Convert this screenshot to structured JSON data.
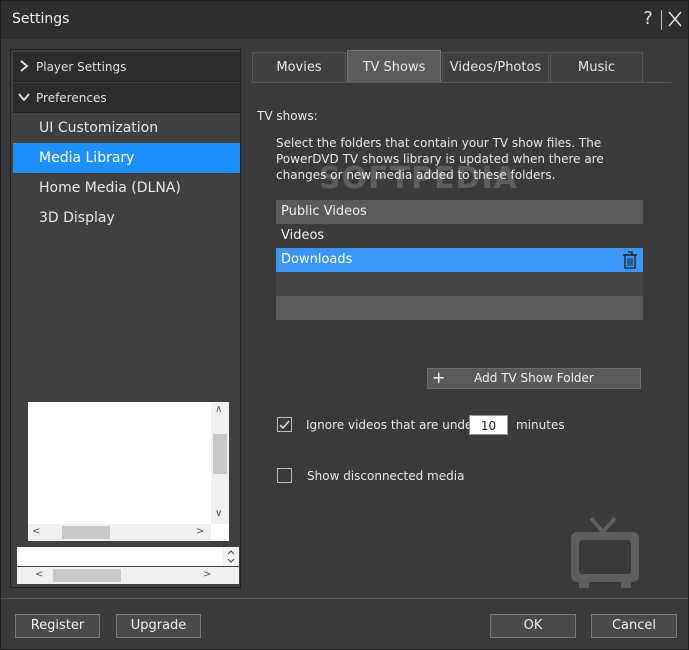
{
  "window": {
    "title": "Settings",
    "help_label": "?"
  },
  "sidebar": {
    "sections": [
      {
        "label": "Player Settings",
        "icon": "chevron-right-icon"
      },
      {
        "label": "Preferences",
        "icon": "chevron-down-icon"
      }
    ],
    "items": [
      {
        "label": "UI Customization"
      },
      {
        "label": "Media Library"
      },
      {
        "label": "Home Media (DLNA)"
      },
      {
        "label": "3D Display"
      }
    ],
    "selected": "Media Library"
  },
  "tabs": [
    {
      "label": "Movies"
    },
    {
      "label": "TV Shows"
    },
    {
      "label": "Videos/Photos"
    },
    {
      "label": "Music"
    }
  ],
  "active_tab": "TV Shows",
  "main": {
    "section_title": "TV shows:",
    "description": "Select the folders that contain your TV show files. The PowerDVD TV shows library is updated when there are changes or new media added to these folders.",
    "folders": [
      "Public Videos",
      "Videos",
      "Downloads"
    ],
    "selected_folder": "Downloads",
    "add_button": "Add TV Show Folder",
    "ignore_label": "Ignore videos that are under",
    "ignore_value": "10",
    "ignore_unit": "minutes",
    "ignore_checked": true,
    "show_disconnected_label": "Show disconnected media",
    "show_disconnected_checked": false
  },
  "footer": {
    "register": "Register",
    "upgrade": "Upgrade",
    "ok": "OK",
    "cancel": "Cancel"
  },
  "watermark": "SOFTPEDIA",
  "colors": {
    "accent": "#1e90ff",
    "selected_row": "#3a95f5",
    "background": "#3a3a3a"
  }
}
